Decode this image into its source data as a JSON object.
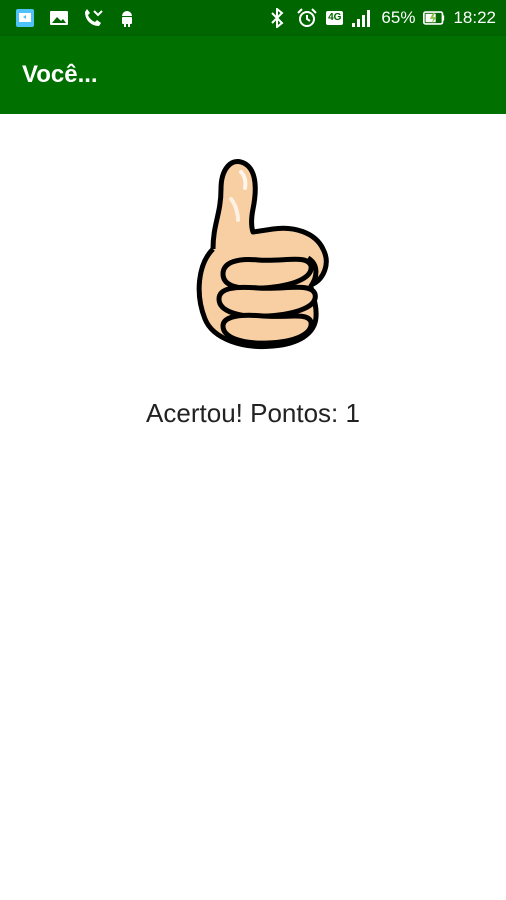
{
  "status_bar": {
    "battery_percent": "65%",
    "time": "18:22",
    "network": "4G",
    "icons": [
      "screen-share-icon",
      "gallery-icon",
      "missed-call-icon",
      "android-debug-icon",
      "bluetooth-icon",
      "alarm-icon",
      "network-4g-icon",
      "signal-icon",
      "battery-charging-icon"
    ],
    "background_color": "#006600"
  },
  "app_bar": {
    "title": "Você...",
    "background_color": "#007000"
  },
  "main": {
    "image_icon": "thumbs-up-icon",
    "result_text": "Acertou! Pontos: 1"
  }
}
